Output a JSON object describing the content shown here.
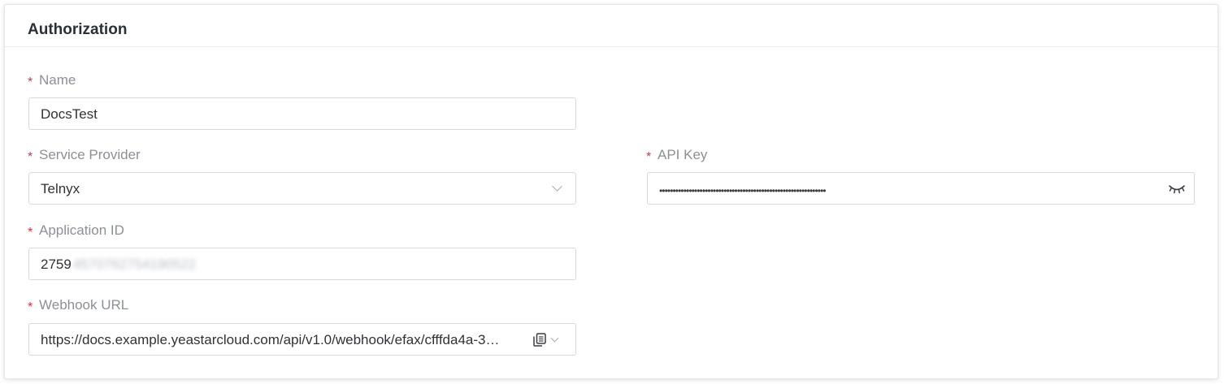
{
  "section": {
    "title": "Authorization"
  },
  "form": {
    "name": {
      "required_mark": "*",
      "label": "Name",
      "value": "DocsTest"
    },
    "service_provider": {
      "required_mark": "*",
      "label": "Service Provider",
      "selected": "Telnyx",
      "icon": "chevron-down-icon"
    },
    "api_key": {
      "required_mark": "*",
      "label": "API Key",
      "masked_value": "••••••••••••••••••••••••••••••••••••••••••••••••••••••••••••••",
      "icon": "eye-closed-icon"
    },
    "application_id": {
      "required_mark": "*",
      "label": "Application ID",
      "value_visible": "2759",
      "value_obscured": "4570762754190522"
    },
    "webhook_url": {
      "required_mark": "*",
      "label": "Webhook URL",
      "value": "https://docs.example.yeastarcloud.com/api/v1.0/webhook/efax/cfffda4a-3…",
      "icons": [
        "copy-icon",
        "chevron-down-icon"
      ]
    }
  },
  "colors": {
    "required": "#e0343c",
    "label": "#8c9097",
    "border": "#d7d9dc",
    "text": "#2f3236"
  }
}
